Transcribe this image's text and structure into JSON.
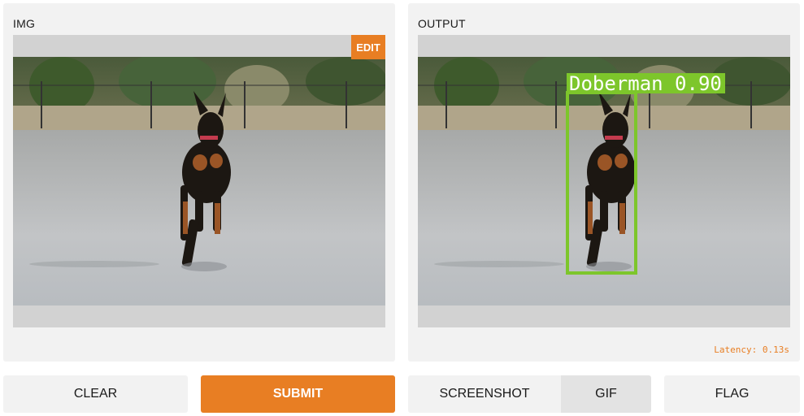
{
  "input_panel": {
    "label": "IMG",
    "edit_label": "EDIT"
  },
  "output_panel": {
    "label": "OUTPUT",
    "detection": {
      "class": "Doberman",
      "score": "0.90",
      "text": "Doberman 0.90",
      "color": "#7dc62b"
    },
    "latency": "Latency: 0.13s"
  },
  "buttons": {
    "clear": "CLEAR",
    "submit": "SUBMIT",
    "screenshot": "SCREENSHOT",
    "gif": "GIF",
    "flag": "FLAG"
  },
  "colors": {
    "accent": "#e87e23",
    "panel_bg": "#f2f2f2",
    "frame_bg": "#d2d2d2"
  },
  "icons": {
    "photo": "dog-photo-image"
  }
}
